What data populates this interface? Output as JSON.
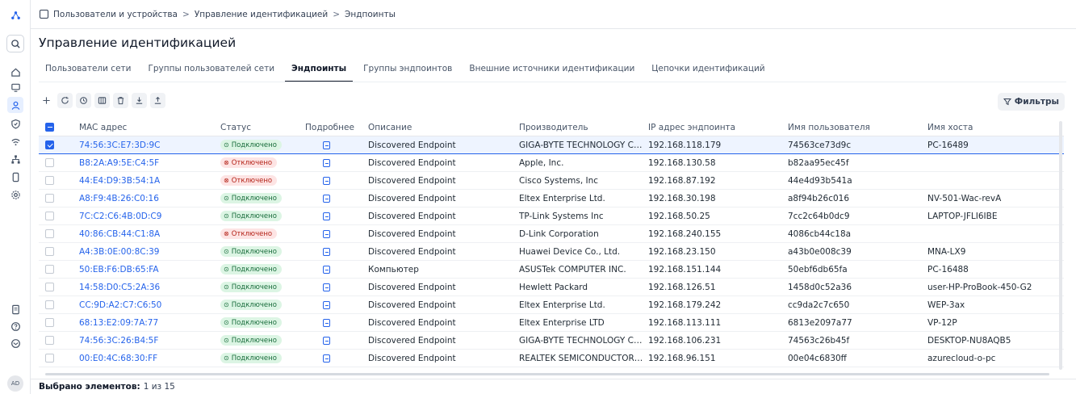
{
  "breadcrumb": [
    "Пользователи и устройства",
    "Управление идентификацией",
    "Эндпоинты"
  ],
  "breadcrumb_sep": ">",
  "page_title": "Управление идентификацией",
  "tabs": [
    {
      "label": "Пользователи сети",
      "active": false
    },
    {
      "label": "Группы пользователей сети",
      "active": false
    },
    {
      "label": "Эндпоинты",
      "active": true
    },
    {
      "label": "Группы эндпоинтов",
      "active": false
    },
    {
      "label": "Внешние источники идентификации",
      "active": false
    },
    {
      "label": "Цепочки идентификаций",
      "active": false
    }
  ],
  "toolbar": {
    "icons": [
      "plus-icon",
      "refresh-icon",
      "history-icon",
      "columns-icon",
      "trash-icon",
      "import-icon",
      "export-icon"
    ],
    "filters_label": "Фильтры"
  },
  "table": {
    "headers": [
      "MAC адрес",
      "Статус",
      "Подробнее",
      "Описание",
      "Производитель",
      "IP адрес эндпоинта",
      "Имя пользователя",
      "Имя хоста"
    ],
    "rows": [
      {
        "mac": "74:56:3C:E7:3D:9C",
        "status": "Подключено",
        "status_kind": "ok",
        "desc": "Discovered Endpoint",
        "vendor": "GIGA-BYTE TECHNOLOGY CO.,L...",
        "ip": "192.168.118.179",
        "user": "74563ce73d9c",
        "host": "PC-16489",
        "selected": true
      },
      {
        "mac": "B8:2A:A9:5E:C4:5F",
        "status": "Отключено",
        "status_kind": "off",
        "desc": "Discovered Endpoint",
        "vendor": "Apple, Inc.",
        "ip": "192.168.130.58",
        "user": "b82aa95ec45f",
        "host": "",
        "selected": false
      },
      {
        "mac": "44:E4:D9:3B:54:1A",
        "status": "Отключено",
        "status_kind": "off",
        "desc": "Discovered Endpoint",
        "vendor": "Cisco Systems, Inc",
        "ip": "192.168.87.192",
        "user": "44e4d93b541a",
        "host": "",
        "selected": false
      },
      {
        "mac": "A8:F9:4B:26:C0:16",
        "status": "Подключено",
        "status_kind": "ok",
        "desc": "Discovered Endpoint",
        "vendor": "Eltex Enterprise Ltd.",
        "ip": "192.168.30.198",
        "user": "a8f94b26c016",
        "host": "NV-501-Wac-revA",
        "selected": false
      },
      {
        "mac": "7C:C2:C6:4B:0D:C9",
        "status": "Подключено",
        "status_kind": "ok",
        "desc": "Discovered Endpoint",
        "vendor": "TP-Link Systems Inc",
        "ip": "192.168.50.25",
        "user": "7cc2c64b0dc9",
        "host": "LAPTOP-JFLI6IBE",
        "selected": false
      },
      {
        "mac": "40:86:CB:44:C1:8A",
        "status": "Отключено",
        "status_kind": "off",
        "desc": "Discovered Endpoint",
        "vendor": "D-Link Corporation",
        "ip": "192.168.240.155",
        "user": "4086cb44c18a",
        "host": "",
        "selected": false
      },
      {
        "mac": "A4:3B:0E:00:8C:39",
        "status": "Подключено",
        "status_kind": "ok",
        "desc": "Discovered Endpoint",
        "vendor": "Huawei Device Co., Ltd.",
        "ip": "192.168.23.150",
        "user": "a43b0e008c39",
        "host": "MNA-LX9",
        "selected": false
      },
      {
        "mac": "50:EB:F6:DB:65:FA",
        "status": "Подключено",
        "status_kind": "ok",
        "desc": "Компьютер",
        "vendor": "ASUSTek COMPUTER INC.",
        "ip": "192.168.151.144",
        "user": "50ebf6db65fa",
        "host": "PC-16488",
        "selected": false
      },
      {
        "mac": "14:58:D0:C5:2A:36",
        "status": "Подключено",
        "status_kind": "ok",
        "desc": "Discovered Endpoint",
        "vendor": "Hewlett Packard",
        "ip": "192.168.126.51",
        "user": "1458d0c52a36",
        "host": "user-HP-ProBook-450-G2",
        "selected": false
      },
      {
        "mac": "CC:9D:A2:C7:C6:50",
        "status": "Подключено",
        "status_kind": "ok",
        "desc": "Discovered Endpoint",
        "vendor": "Eltex Enterprise Ltd.",
        "ip": "192.168.179.242",
        "user": "cc9da2c7c650",
        "host": "WEP-3ax",
        "selected": false
      },
      {
        "mac": "68:13:E2:09:7A:77",
        "status": "Подключено",
        "status_kind": "ok",
        "desc": "Discovered Endpoint",
        "vendor": "Eltex Enterprise LTD",
        "ip": "192.168.113.111",
        "user": "6813e2097a77",
        "host": "VP-12P",
        "selected": false
      },
      {
        "mac": "74:56:3C:26:B4:5F",
        "status": "Подключено",
        "status_kind": "ok",
        "desc": "Discovered Endpoint",
        "vendor": "GIGA-BYTE TECHNOLOGY CO.,L...",
        "ip": "192.168.106.231",
        "user": "74563c26b45f",
        "host": "DESKTOP-NU8AQB5",
        "selected": false
      },
      {
        "mac": "00:E0:4C:68:30:FF",
        "status": "Подключено",
        "status_kind": "ok",
        "desc": "Discovered Endpoint",
        "vendor": "REALTEK SEMICONDUCTOR CO...",
        "ip": "192.168.96.151",
        "user": "00e04c6830ff",
        "host": "azurecloud-o-pc",
        "selected": false
      }
    ]
  },
  "footer": {
    "label": "Выбрано элементов:",
    "value": "1 из 15"
  },
  "user": {
    "initials": "AD"
  },
  "colors": {
    "accent": "#2563eb",
    "ok_bg": "#dcf5e4",
    "off_bg": "#fde4e4"
  }
}
